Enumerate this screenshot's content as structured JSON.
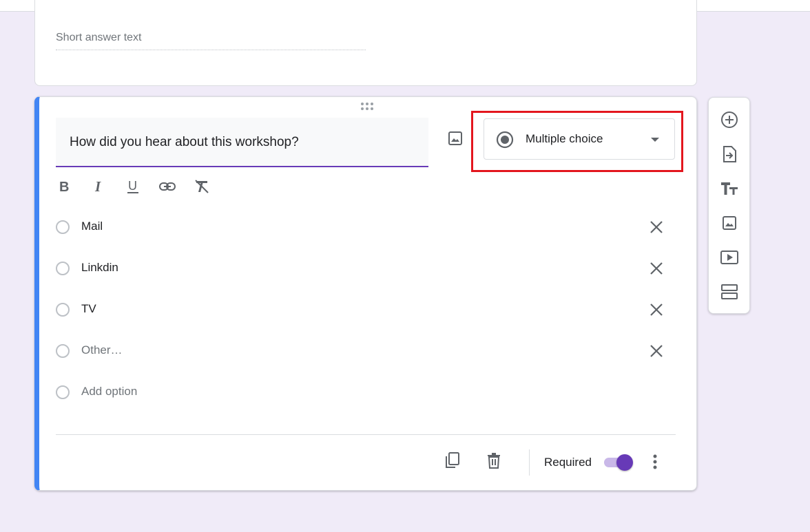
{
  "previous_question": {
    "answer_placeholder": "Short answer text"
  },
  "question": {
    "title": "How did you hear about this workshop?",
    "type_selected": "Multiple choice",
    "options": [
      {
        "label": "Mail"
      },
      {
        "label": "Linkdin"
      },
      {
        "label": "TV"
      },
      {
        "label": "Other…"
      }
    ],
    "add_option_label": "Add option",
    "required_label": "Required",
    "required_on": true
  },
  "format_toolbar": [
    "bold-icon",
    "italic-icon",
    "underline-icon",
    "link-icon",
    "clear-format-icon"
  ],
  "side_toolbar": [
    "add-question-icon",
    "import-questions-icon",
    "add-title-icon",
    "add-image-icon",
    "add-video-icon",
    "add-section-icon"
  ],
  "colors": {
    "accent": "#673ab7",
    "active_border": "#4285f4",
    "highlight": "#e3161e",
    "background": "#f0ebf8"
  }
}
